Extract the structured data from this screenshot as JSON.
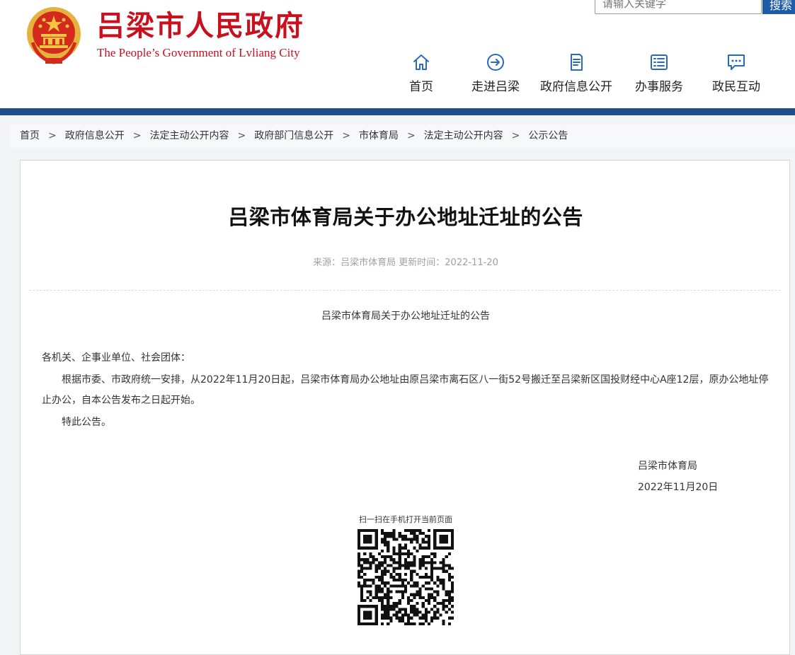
{
  "header": {
    "site_title": "吕梁市人民政府",
    "site_subtitle": "The People’s Government of Lvliang City",
    "search": {
      "placeholder": "请输入关键字",
      "button_label": "搜索"
    },
    "nav": [
      {
        "label": "首页",
        "icon": "home-icon"
      },
      {
        "label": "走进吕梁",
        "icon": "arrow-circle-icon"
      },
      {
        "label": "政府信息公开",
        "icon": "document-icon"
      },
      {
        "label": "办事服务",
        "icon": "list-icon"
      },
      {
        "label": "政民互动",
        "icon": "chat-icon"
      }
    ]
  },
  "breadcrumb": [
    "首页",
    "政府信息公开",
    "法定主动公开内容",
    "政府部门信息公开",
    "市体育局",
    "法定主动公开内容",
    "公示公告"
  ],
  "article": {
    "title": "吕梁市体育局关于办公地址迁址的公告",
    "meta": "来源：吕梁市体育局 更新时间：2022-11-20",
    "subtitle": "吕梁市体育局关于办公地址迁址的公告",
    "salutation": "各机关、企事业单位、社会团体：",
    "body": "根据市委、市政府统一安排，从2022年11月20日起，吕梁市体育局办公地址由原吕梁市离石区八一街52号搬迁至吕梁新区国投财经中心A座12层，原办公地址停止办公，自本公告发布之日起开始。",
    "closing": "特此公告。",
    "signature_org": "吕梁市体育局",
    "signature_date": "2022年11月20日"
  },
  "qr": {
    "caption": "扫一扫在手机打开当前页面"
  },
  "colors": {
    "brand_red": "#c8101e",
    "brand_blue": "#1e4f8c",
    "nav_icon_blue": "#2a6bb8"
  }
}
